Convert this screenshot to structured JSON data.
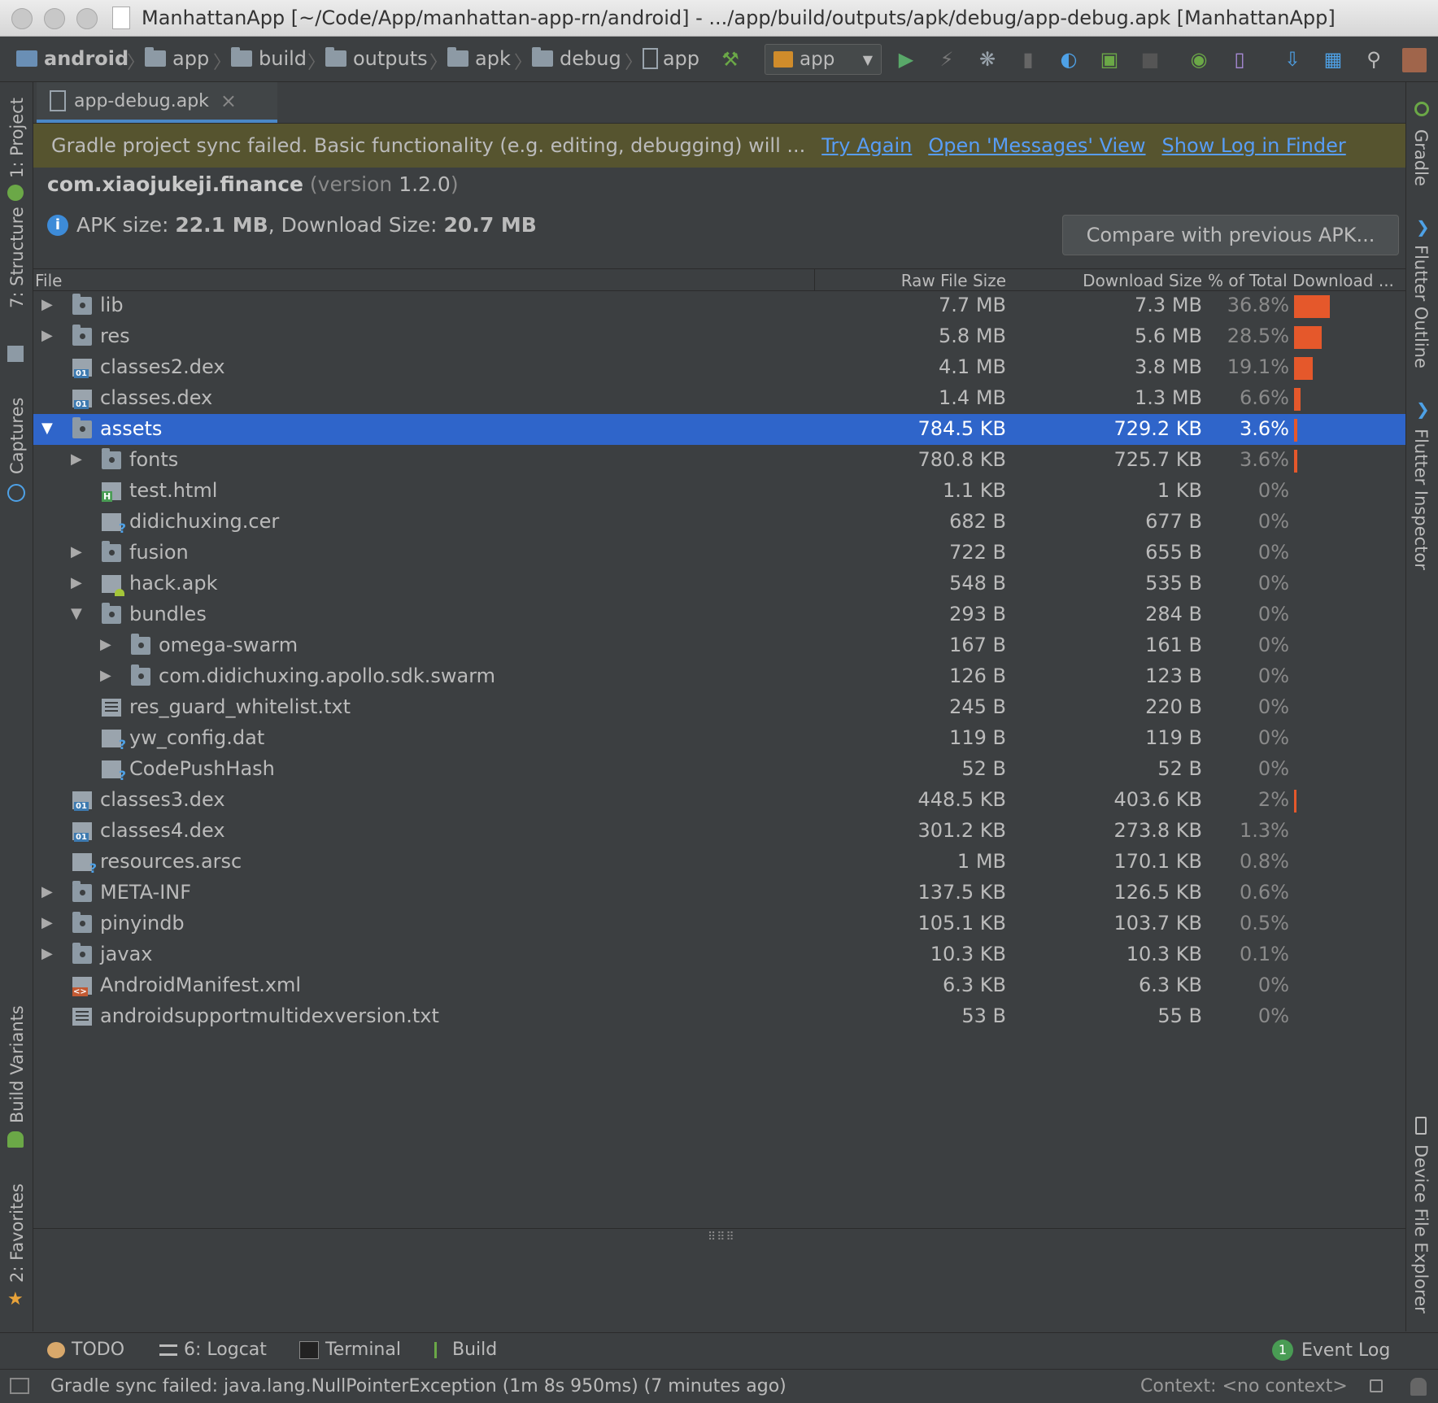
{
  "window": {
    "title": "ManhattanApp [~/Code/App/manhattan-app-rn/android] - .../app/build/outputs/apk/debug/app-debug.apk [ManhattanApp]"
  },
  "breadcrumb": [
    "android",
    "app",
    "build",
    "outputs",
    "apk",
    "debug",
    "app"
  ],
  "run_config": {
    "selected": "app"
  },
  "editor_tab": {
    "label": "app-debug.apk",
    "close": "×"
  },
  "banner": {
    "message": "Gradle project sync failed. Basic functionality (e.g. editing, debugging) will ...",
    "link_try_again": "Try Again",
    "link_messages": "Open 'Messages' View",
    "link_show_log": "Show Log in Finder"
  },
  "apk": {
    "package": "com.xiaojukeji.finance",
    "version_prefix": "(version",
    "version": "1.2.0",
    "version_suffix": ")",
    "apk_size_label": "APK size:",
    "apk_size": "22.1 MB",
    "download_size_label": "Download Size:",
    "download_size": "20.7 MB",
    "compare_button": "Compare with previous APK..."
  },
  "table": {
    "columns": [
      "File",
      "Raw File Size",
      "Download Size",
      "% of Total Download ..."
    ],
    "rows": [
      {
        "name": "lib",
        "raw": "7.7 MB",
        "download": "7.3 MB",
        "pct": "36.8%",
        "share": 36.8,
        "depth": 0,
        "expand": "collapsed",
        "icon": "folder-icon"
      },
      {
        "name": "res",
        "raw": "5.8 MB",
        "download": "5.6 MB",
        "pct": "28.5%",
        "share": 28.5,
        "depth": 0,
        "expand": "collapsed",
        "icon": "res-folder-icon"
      },
      {
        "name": "classes2.dex",
        "raw": "4.1 MB",
        "download": "3.8 MB",
        "pct": "19.1%",
        "share": 19.1,
        "depth": 0,
        "expand": "none",
        "icon": "dex-file-icon"
      },
      {
        "name": "classes.dex",
        "raw": "1.4 MB",
        "download": "1.3 MB",
        "pct": "6.6%",
        "share": 6.6,
        "depth": 0,
        "expand": "none",
        "icon": "dex-file-icon"
      },
      {
        "name": "assets",
        "raw": "784.5 KB",
        "download": "729.2 KB",
        "pct": "3.6%",
        "share": 3.6,
        "depth": 0,
        "expand": "expanded",
        "icon": "folder-icon",
        "selected": true
      },
      {
        "name": "fonts",
        "raw": "780.8 KB",
        "download": "725.7 KB",
        "pct": "3.6%",
        "share": 3.6,
        "depth": 1,
        "expand": "collapsed",
        "icon": "folder-icon"
      },
      {
        "name": "test.html",
        "raw": "1.1 KB",
        "download": "1 KB",
        "pct": "0%",
        "share": 0,
        "depth": 1,
        "expand": "none",
        "icon": "html-file-icon"
      },
      {
        "name": "didichuxing.cer",
        "raw": "682 B",
        "download": "677 B",
        "pct": "0%",
        "share": 0,
        "depth": 1,
        "expand": "none",
        "icon": "unknown-file-icon"
      },
      {
        "name": "fusion",
        "raw": "722 B",
        "download": "655 B",
        "pct": "0%",
        "share": 0,
        "depth": 1,
        "expand": "collapsed",
        "icon": "folder-icon"
      },
      {
        "name": "hack.apk",
        "raw": "548 B",
        "download": "535 B",
        "pct": "0%",
        "share": 0,
        "depth": 1,
        "expand": "collapsed",
        "icon": "apk-file-icon"
      },
      {
        "name": "bundles",
        "raw": "293 B",
        "download": "284 B",
        "pct": "0%",
        "share": 0,
        "depth": 1,
        "expand": "expanded",
        "icon": "folder-icon"
      },
      {
        "name": "omega-swarm",
        "raw": "167 B",
        "download": "161 B",
        "pct": "0%",
        "share": 0,
        "depth": 2,
        "expand": "collapsed",
        "icon": "folder-icon"
      },
      {
        "name": "com.didichuxing.apollo.sdk.swarm",
        "raw": "126 B",
        "download": "123 B",
        "pct": "0%",
        "share": 0,
        "depth": 2,
        "expand": "collapsed",
        "icon": "folder-icon"
      },
      {
        "name": "res_guard_whitelist.txt",
        "raw": "245 B",
        "download": "220 B",
        "pct": "0%",
        "share": 0,
        "depth": 1,
        "expand": "none",
        "icon": "text-file-icon"
      },
      {
        "name": "yw_config.dat",
        "raw": "119 B",
        "download": "119 B",
        "pct": "0%",
        "share": 0,
        "depth": 1,
        "expand": "none",
        "icon": "unknown-file-icon"
      },
      {
        "name": "CodePushHash",
        "raw": "52 B",
        "download": "52 B",
        "pct": "0%",
        "share": 0,
        "depth": 1,
        "expand": "none",
        "icon": "unknown-file-icon"
      },
      {
        "name": "classes3.dex",
        "raw": "448.5 KB",
        "download": "403.6 KB",
        "pct": "2%",
        "share": 2,
        "depth": 0,
        "expand": "none",
        "icon": "dex-file-icon"
      },
      {
        "name": "classes4.dex",
        "raw": "301.2 KB",
        "download": "273.8 KB",
        "pct": "1.3%",
        "share": 0,
        "depth": 0,
        "expand": "none",
        "icon": "dex-file-icon"
      },
      {
        "name": "resources.arsc",
        "raw": "1 MB",
        "download": "170.1 KB",
        "pct": "0.8%",
        "share": 0,
        "depth": 0,
        "expand": "none",
        "icon": "unknown-file-icon"
      },
      {
        "name": "META-INF",
        "raw": "137.5 KB",
        "download": "126.5 KB",
        "pct": "0.6%",
        "share": 0,
        "depth": 0,
        "expand": "collapsed",
        "icon": "folder-icon"
      },
      {
        "name": "pinyindb",
        "raw": "105.1 KB",
        "download": "103.7 KB",
        "pct": "0.5%",
        "share": 0,
        "depth": 0,
        "expand": "collapsed",
        "icon": "folder-icon"
      },
      {
        "name": "javax",
        "raw": "10.3 KB",
        "download": "10.3 KB",
        "pct": "0.1%",
        "share": 0,
        "depth": 0,
        "expand": "collapsed",
        "icon": "folder-icon"
      },
      {
        "name": "AndroidManifest.xml",
        "raw": "6.3 KB",
        "download": "6.3 KB",
        "pct": "0%",
        "share": 0,
        "depth": 0,
        "expand": "none",
        "icon": "xml-file-icon"
      },
      {
        "name": "androidsupportmultidexversion.txt",
        "raw": "53 B",
        "download": "55 B",
        "pct": "0%",
        "share": 0,
        "depth": 0,
        "expand": "none",
        "icon": "text-file-icon"
      }
    ]
  },
  "left_tool_tabs": [
    "1: Project",
    "7: Structure",
    "Captures",
    "Build Variants",
    "2: Favorites"
  ],
  "right_tool_tabs": [
    "Gradle",
    "Flutter Outline",
    "Flutter Inspector",
    "Device File Explorer"
  ],
  "bottom_tool_tabs": {
    "todo": "TODO",
    "logcat": "6: Logcat",
    "terminal": "Terminal",
    "build": "Build",
    "event_log": "Event Log",
    "event_count": "1"
  },
  "status": {
    "message": "Gradle sync failed: java.lang.NullPointerException (1m 8s 950ms) (7 minutes ago)",
    "context": "Context: <no context>"
  },
  "colors": {
    "background": "#3c3f41",
    "selection": "#2f65ca",
    "bar": "#e5582b",
    "banner": "#56542f",
    "link": "#589df6"
  }
}
